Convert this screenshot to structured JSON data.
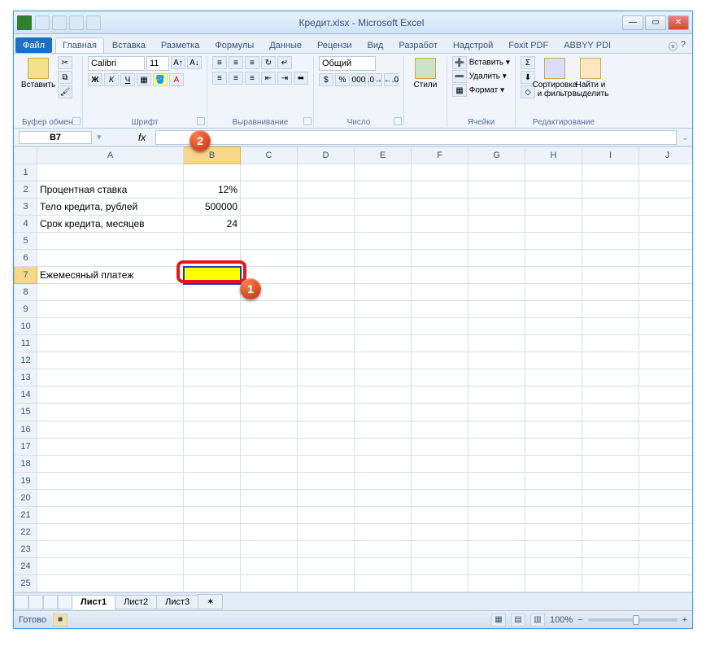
{
  "title": "Кредит.xlsx - Microsoft Excel",
  "tabs": {
    "file": "Файл",
    "home": "Главная",
    "insert": "Вставка",
    "layout": "Разметка",
    "formulas": "Формулы",
    "data": "Данные",
    "review": "Рецензи",
    "view": "Вид",
    "dev": "Разработ",
    "addins": "Надстрой",
    "foxit": "Foxit PDF",
    "abbyy": "ABBYY PDI"
  },
  "groups": {
    "clipboard": "Буфер обмена",
    "paste": "Вставить",
    "font": "Шрифт",
    "fontname": "Calibri",
    "fontsize": "11",
    "align": "Выравнивание",
    "number": "Число",
    "numfmt": "Общий",
    "styles": "Стили",
    "cells": "Ячейки",
    "ins": "Вставить",
    "del": "Удалить",
    "fmt": "Формат",
    "edit": "Редактирование",
    "sort": "Сортировка и фильтр",
    "find": "Найти и выделить"
  },
  "namebox": "B7",
  "columns": [
    "A",
    "B",
    "C",
    "D",
    "E",
    "F",
    "G",
    "H",
    "I",
    "J"
  ],
  "cells": {
    "A2": "Процентная ставка",
    "B2": "12%",
    "A3": "Тело кредита, рублей",
    "B3": "500000",
    "A4": "Срок кредита, месяцев",
    "B4": "24",
    "A7": "Ежемесяный платеж"
  },
  "sheets": {
    "s1": "Лист1",
    "s2": "Лист2",
    "s3": "Лист3"
  },
  "status": "Готово",
  "zoom": "100%",
  "badges": {
    "b1": "1",
    "b2": "2"
  }
}
